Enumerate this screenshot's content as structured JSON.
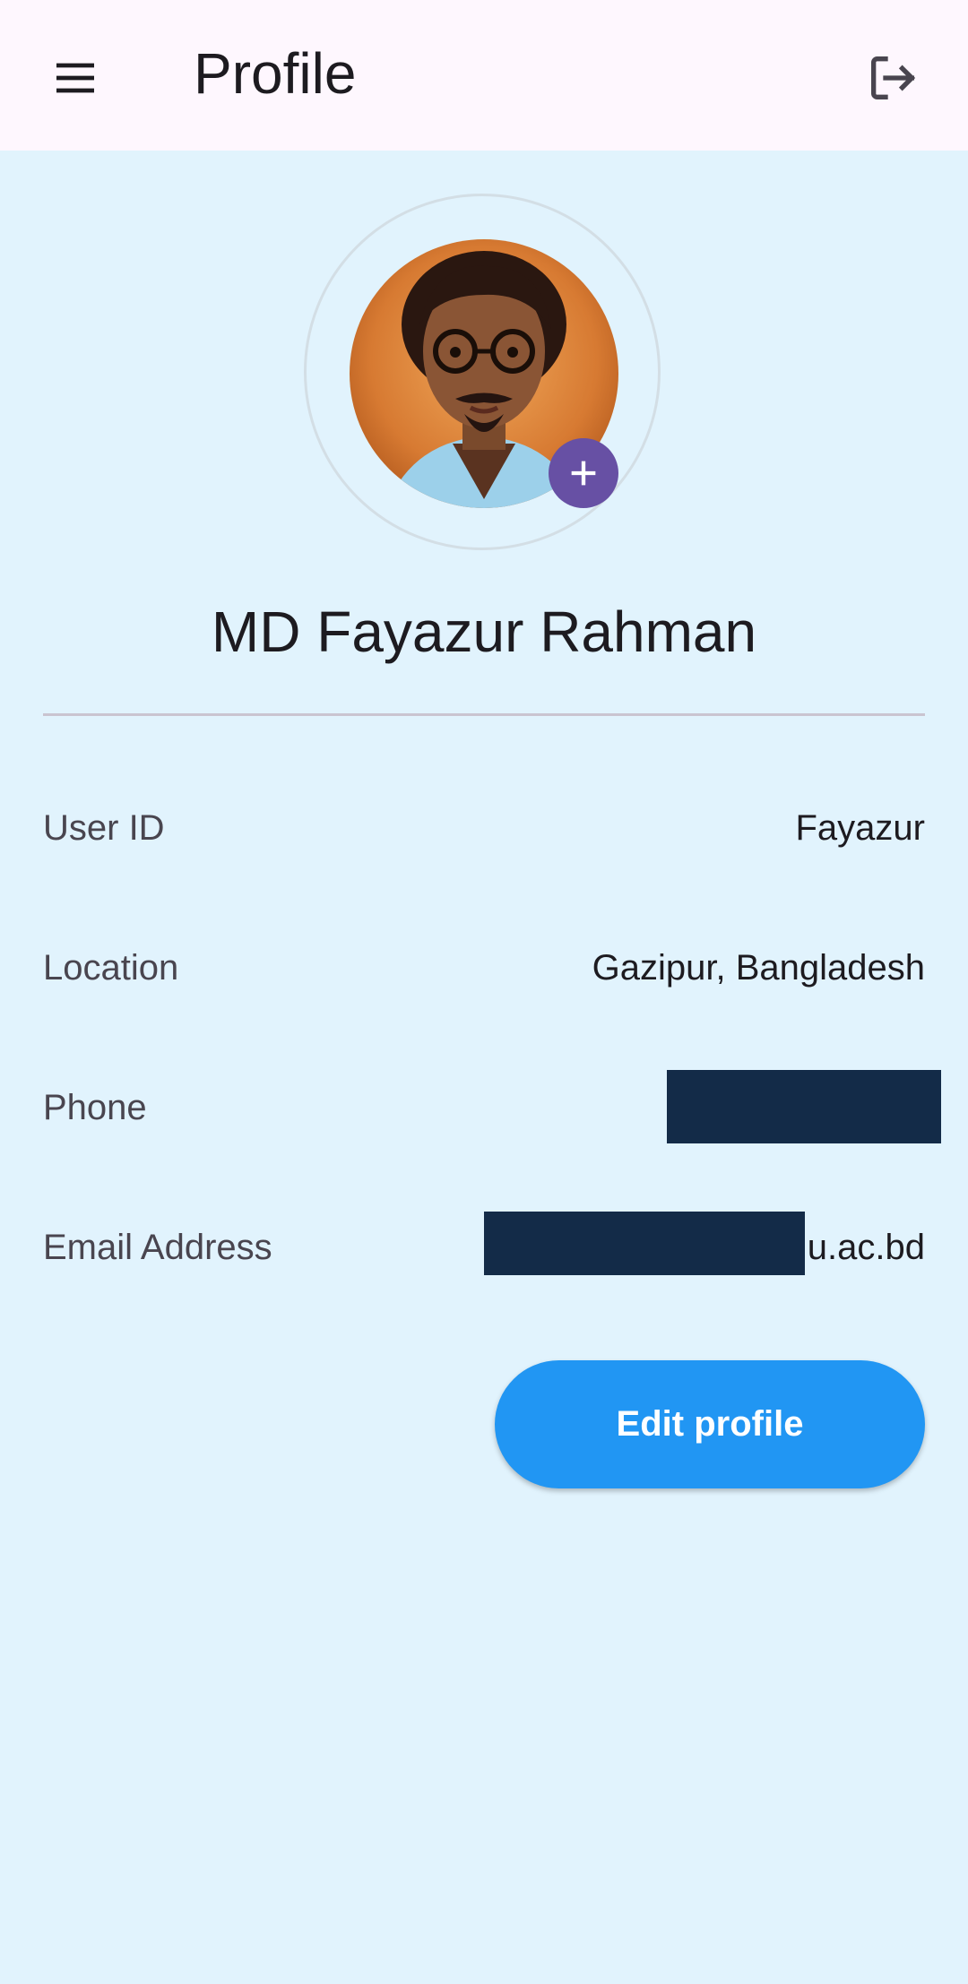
{
  "appbar": {
    "title": "Profile",
    "menu_icon": "menu-icon",
    "logout_icon": "logout-icon"
  },
  "profile": {
    "name": "MD Fayazur Rahman",
    "avatar_icon": "avatar-portrait",
    "add_photo_icon": "plus-icon"
  },
  "fields": [
    {
      "label": "User ID",
      "value": "Fayazur"
    },
    {
      "label": "Location",
      "value": "Gazipur, Bangladesh"
    },
    {
      "label": "Phone",
      "value": ""
    },
    {
      "label": "Email Address",
      "value": "u.ac.bd"
    }
  ],
  "actions": {
    "edit_label": "Edit profile"
  },
  "colors": {
    "background": "#e1f3fd",
    "appbar": "#fef7fe",
    "primary_button": "#2196f3",
    "add_photo": "#6750a4",
    "redaction": "#132b48"
  }
}
